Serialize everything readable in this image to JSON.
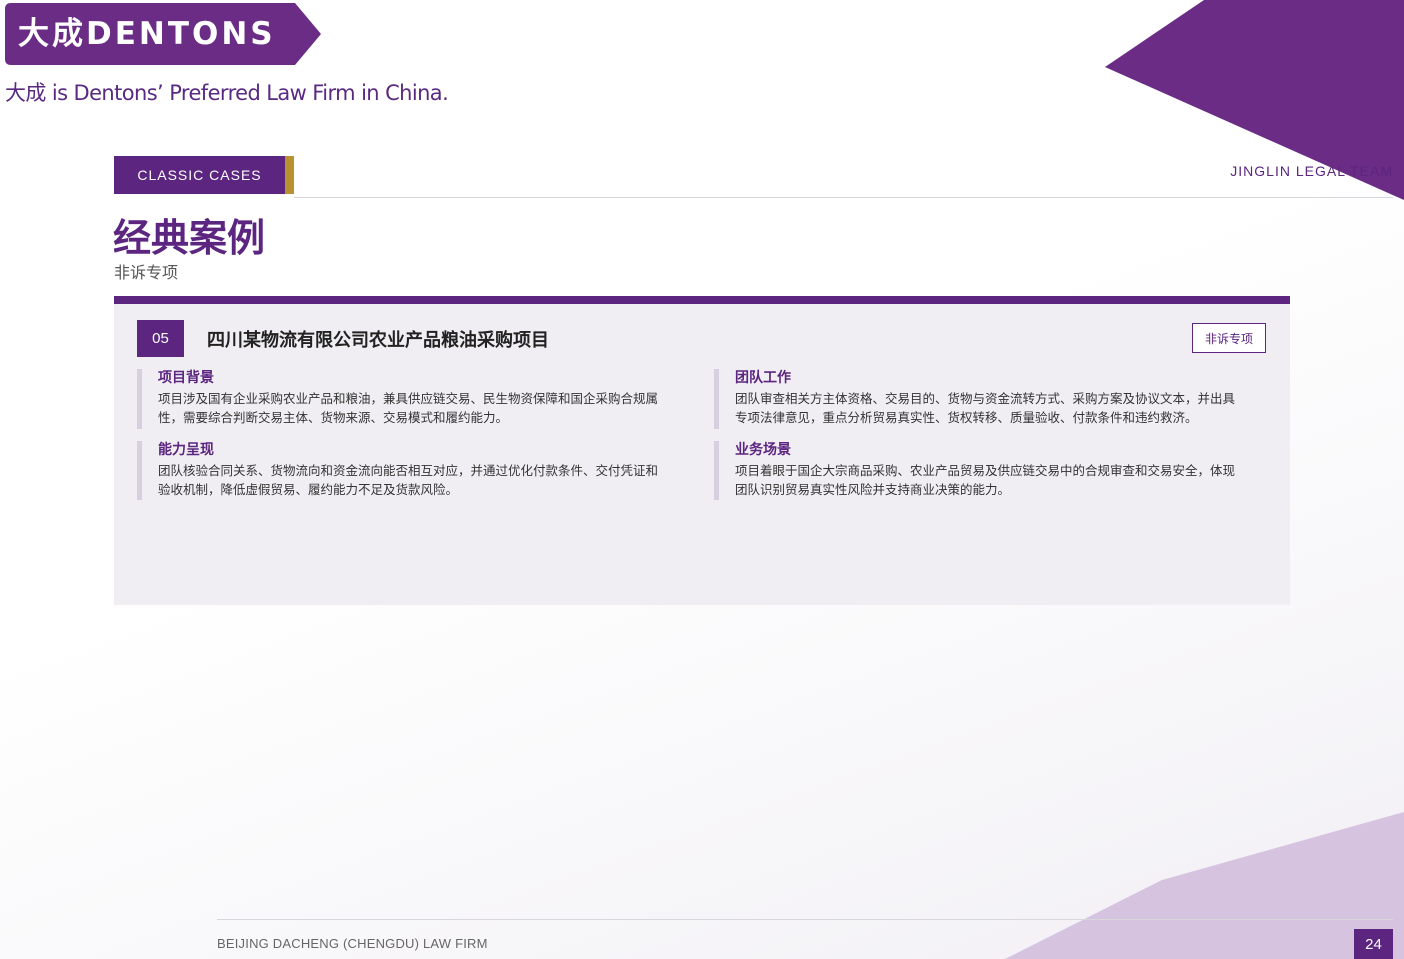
{
  "brand": {
    "logo_text": "大成DENTONS",
    "tagline": "大成 is Dentons’ Preferred Law Firm in China."
  },
  "header": {
    "section_tag": "CLASSIC CASES",
    "team_label": "JINGLIN LEGAL TEAM",
    "title": "经典案例",
    "subtitle": "非诉专项"
  },
  "case": {
    "number": "05",
    "title": "四川某物流有限公司农业产品粮油采购项目",
    "badge": "非诉专项",
    "blocks": [
      {
        "title": "项目背景",
        "lines": [
          "项目涉及国有企业采购农业产品和粮油，兼具供应链交易、民生物资保障和国企采购合规属",
          "性，需要综合判断交易主体、货物来源、交易模式和履约能力。"
        ]
      },
      {
        "title": "团队工作",
        "lines": [
          "团队审查相关方主体资格、交易目的、货物与资金流转方式、采购方案及协议文本，并出具",
          "专项法律意见，重点分析贸易真实性、货权转移、质量验收、付款条件和违约救济。"
        ]
      },
      {
        "title": "能力呈现",
        "lines": [
          "团队核验合同关系、货物流向和资金流向能否相互对应，并通过优化付款条件、交付凭证和",
          "验收机制，降低虚假贸易、履约能力不足及货款风险。"
        ]
      },
      {
        "title": "业务场景",
        "lines": [
          "项目着眼于国企大宗商品采购、农业产品贸易及供应链交易中的合规审查和交易安全，体现",
          "团队识别贸易真实性风险并支持商业决策的能力。"
        ]
      }
    ]
  },
  "footer": {
    "firm_name": "BEIJING DACHENG (CHENGDU) LAW FIRM",
    "page_number": "24"
  },
  "colors": {
    "brand_purple": "#5b2580",
    "accent_gold": "#b8922e",
    "deco_light_purple": "#d6c3e0"
  }
}
